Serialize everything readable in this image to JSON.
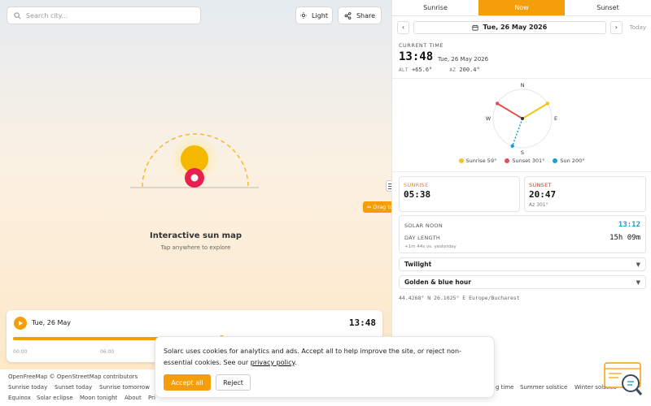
{
  "search": {
    "placeholder": "Search city..."
  },
  "top_buttons": {
    "light": "Light",
    "share": "Share"
  },
  "map": {
    "title": "Interactive sun map",
    "subtitle": "Tap anywhere to explore"
  },
  "timeline": {
    "date": "Tue, 26 May",
    "time": "13:48",
    "ticks": [
      "00:00",
      "06:00"
    ],
    "progress": 0.575
  },
  "drag": {
    "tooltip": "⇔ Drag to resize"
  },
  "panel": {
    "tabs": [
      "Sunrise",
      "Now",
      "Sunset"
    ],
    "active_tab": 1,
    "date": "Tue, 26 May 2026",
    "today": "Today",
    "current_label": "CURRENT TIME",
    "current_time": "13:48",
    "current_date": "Tue, 26 May 2026",
    "alt_label": "ALT",
    "alt_value": "+65.6°",
    "az_label": "AZ",
    "az_value": "200.4°",
    "compass": {
      "n": "N",
      "e": "E",
      "s": "S",
      "w": "W",
      "sunrise_az": 59,
      "sunset_az": 301,
      "sun_az": 200
    },
    "legend": [
      "Sunrise 59°",
      "Sunset 301°",
      "Sun 200°"
    ],
    "sunrise": {
      "label": "SUNRISE",
      "time": "05:38"
    },
    "sunset": {
      "label": "SUNSET",
      "time": "20:47",
      "az": "Az 301°"
    },
    "solar_noon_label": "SOLAR NOON",
    "solar_noon": "13:12",
    "day_length_label": "DAY LENGTH",
    "day_length": "15h 09m",
    "day_delta": "+1m 44s vs. yesterday",
    "twilight": "Twilight",
    "golden": "Golden & blue hour",
    "coords": "44.4268° N   26.1025° E   Europe/Bucharest"
  },
  "footer": {
    "links": [
      "OpenFreeMap © OpenStreetMap contributors",
      "Sunrise today",
      "Sunset today",
      "Sunrise tomorrow",
      "Equinox",
      "Solar eclipse",
      "Moon tonight",
      "About",
      "Pri",
      "g time",
      "Summer solstice",
      "Winter solstice"
    ]
  },
  "cookie": {
    "text": "Solarc uses cookies for analytics and ads. Accept all to help improve the site, or reject non-essential cookies. See our ",
    "link": "privacy policy",
    "tail": ".",
    "accept": "Accept all",
    "reject": "Reject"
  },
  "colors": {
    "accent": "#f59e0b",
    "sunrise": "#f5c518",
    "sunset": "#e05252",
    "sun": "#1aa0d1",
    "noon": "#1aa0d1",
    "sunrise_label": "#e0871f",
    "sunset_label": "#c0392b"
  }
}
